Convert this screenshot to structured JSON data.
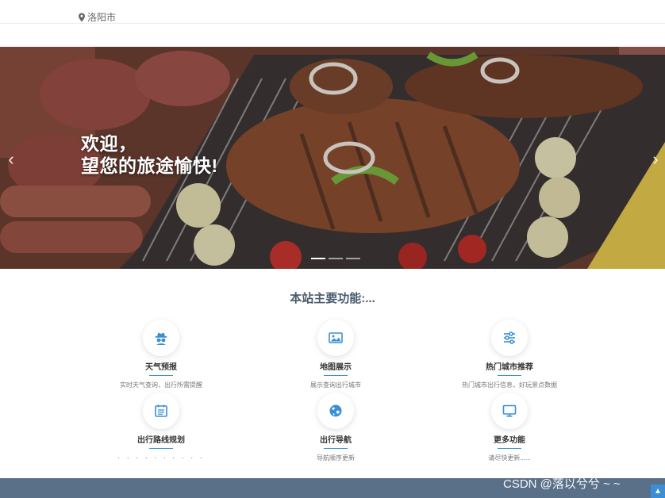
{
  "header": {
    "city": "洛阳市",
    "location_icon": "map-marker-icon"
  },
  "hero": {
    "line1": "欢迎，",
    "line2": "望您的旅途愉快!",
    "prev_icon": "chevron-left-icon",
    "next_icon": "chevron-right-icon",
    "slide_count": 3,
    "active_slide": 1
  },
  "features": {
    "title": "本站主要功能:...",
    "items": [
      {
        "icon": "user-secret-icon",
        "title": "天气预报",
        "desc": "实时天气查询，出行所需提醒"
      },
      {
        "icon": "picture-icon",
        "title": "地图展示",
        "desc": "展示查询出行城市"
      },
      {
        "icon": "sliders-icon",
        "title": "热门城市推荐",
        "desc": "热门城市出行信息，好玩景点数据"
      },
      {
        "icon": "calendar-list-icon",
        "title": "出行路线规划",
        "desc": "· · · · · · · · · ·"
      },
      {
        "icon": "globe-icon",
        "title": "出行导航",
        "desc": "导航顺序更新"
      },
      {
        "icon": "monitor-icon",
        "title": "更多功能",
        "desc": "请尽快更新......"
      }
    ]
  },
  "footer": {
    "watermark": "CSDN @落以兮兮 ~ ~",
    "back_to_top_icon": "chevron-up-icon"
  },
  "colors": {
    "accent": "#3a8fd6",
    "footer": "#5a7089",
    "title": "#4a5b6e"
  }
}
